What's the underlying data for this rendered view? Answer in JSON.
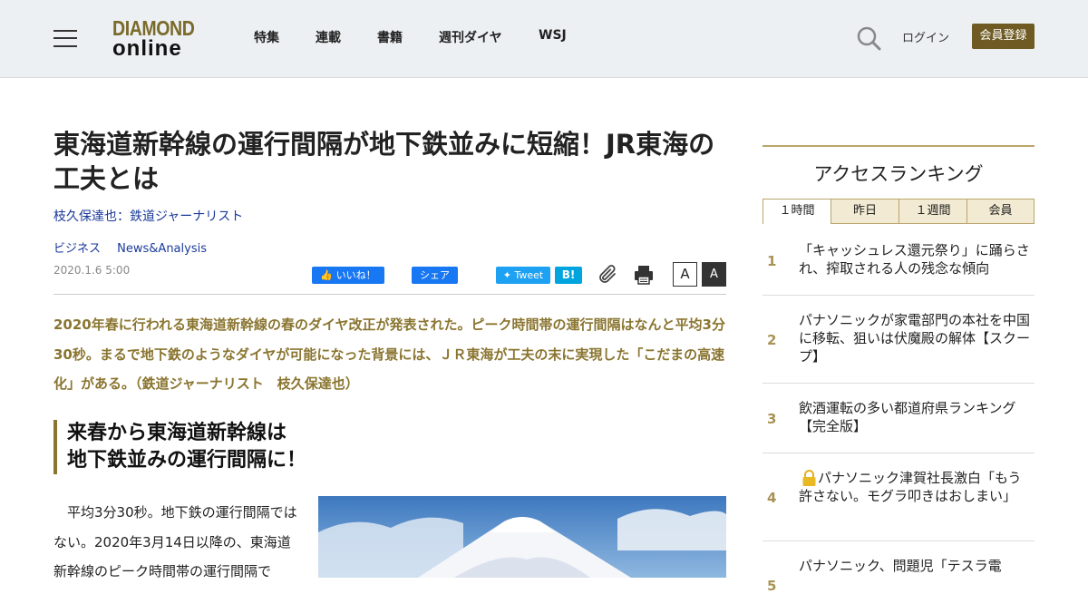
{
  "header": {
    "logo_line1": "DIAMOND",
    "logo_line2": "online",
    "nav": [
      "特集",
      "連載",
      "書籍",
      "週刊ダイヤ",
      "WSJ"
    ],
    "login": "ログイン",
    "register": "会員登録"
  },
  "article": {
    "title": "東海道新幹線の運行間隔が地下鉄並みに短縮！JR東海の工夫とは",
    "author": "枝久保達也：鉄道ジャーナリスト",
    "tags": [
      "ビジネス",
      "News&Analysis"
    ],
    "date": "2020.1.6 5:00",
    "share": {
      "like": "いいね！",
      "share": "シェア",
      "tweet": "Tweet",
      "hatena": "B!",
      "font_small": "A",
      "font_large": "A"
    },
    "lead": "2020年春に行われる東海道新幹線の春のダイヤ改正が発表された。ピーク時間帯の運行間隔はなんと平均3分30秒。まるで地下鉄のようなダイヤが可能になった背景には、ＪＲ東海が工夫の末に実現した「こだまの高速化」がある。（鉄道ジャーナリスト　枝久保達也）",
    "subheading_line1": "来春から東海道新幹線は",
    "subheading_line2": "地下鉄並みの運行間隔に！",
    "body": "平均3分30秒。地下鉄の運行間隔ではない。2020年3月14日以降の、東海道新幹線のピーク時間帯の運行間隔で"
  },
  "ranking": {
    "title": "アクセスランキング",
    "tabs": [
      "１時間",
      "昨日",
      "１週間",
      "会員"
    ],
    "active_tab": "１時間",
    "items": [
      {
        "rank": "1",
        "text": "「キャッシュレス還元祭り」に踊らされ、搾取される人の残念な傾向"
      },
      {
        "rank": "2",
        "text": "パナソニックが家電部門の本社を中国に移転、狙いは伏魔殿の解体【スクープ】"
      },
      {
        "rank": "3",
        "text": "飲酒運転の多い都道府県ランキング【完全版】"
      },
      {
        "rank": "4",
        "text": "パナソニック津賀社長激白「もう許さない。モグラ叩きはおしまい」",
        "locked": true
      },
      {
        "rank": "5",
        "text": "パナソニック、問題児「テスラ電"
      }
    ]
  },
  "colors": {
    "accent_gold": "#8a7530",
    "register_bg": "#6e5a22",
    "link_blue": "#1a3a9a"
  }
}
